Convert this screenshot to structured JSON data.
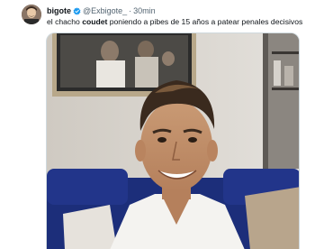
{
  "author": {
    "display_name": "bigote",
    "handle": "@Exbigote_",
    "separator": "·",
    "time": "30min"
  },
  "tweet": {
    "text_before": "el chacho ",
    "text_bold": "coudet",
    "text_after": " poniendo a pibes de 15 años a patear penales decisivos"
  },
  "colors": {
    "verified": "#1d9bf0",
    "secondary_text": "#536471",
    "sofa": "#1c2e7a"
  },
  "icons": {
    "verified": "verified-badge-icon"
  }
}
